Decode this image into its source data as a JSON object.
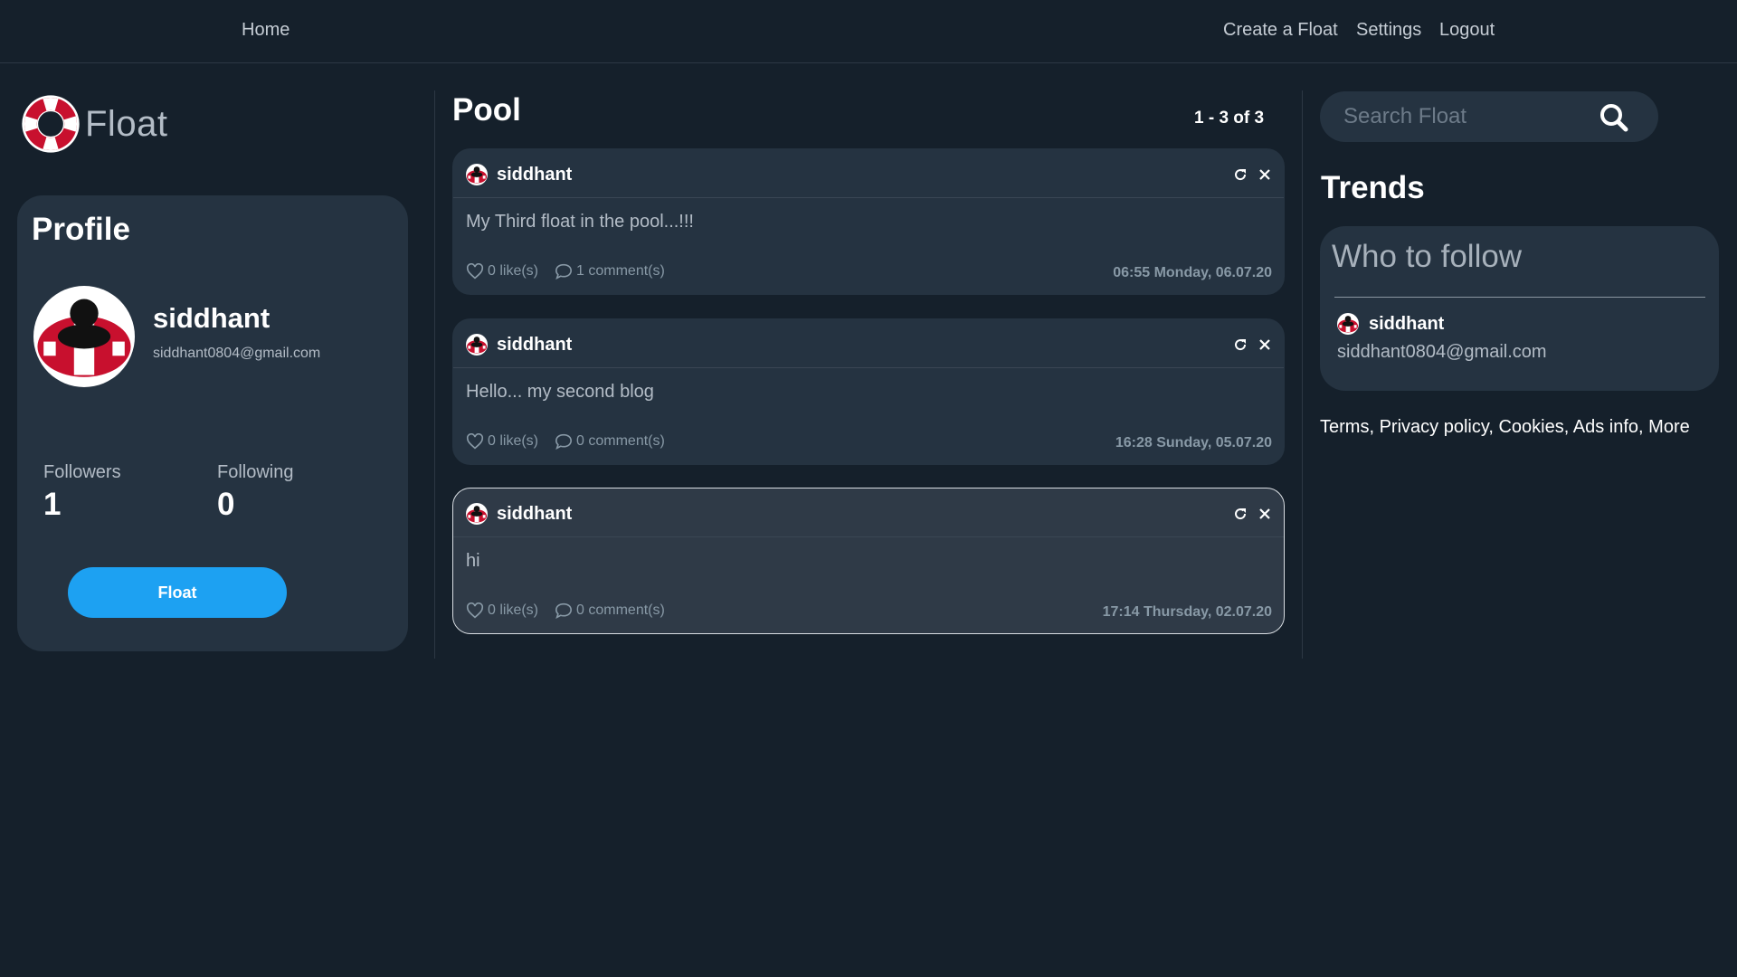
{
  "nav": {
    "home": "Home",
    "create": "Create a Float",
    "settings": "Settings",
    "logout": "Logout"
  },
  "brand": {
    "name": "Float"
  },
  "profile": {
    "title": "Profile",
    "name": "siddhant",
    "email": "siddhant0804@gmail.com",
    "followers_label": "Followers",
    "followers": "1",
    "following_label": "Following",
    "following": "0",
    "float_button": "Float"
  },
  "pool": {
    "title": "Pool",
    "count": "1 - 3 of 3",
    "posts": [
      {
        "author": "siddhant",
        "body": "My Third float in the pool...!!!",
        "likes": "0 like(s)",
        "comments": "1 comment(s)",
        "time": "06:55 Monday, 06.07.20"
      },
      {
        "author": "siddhant",
        "body": "Hello... my second blog",
        "likes": "0 like(s)",
        "comments": "0 comment(s)",
        "time": "16:28 Sunday, 05.07.20"
      },
      {
        "author": "siddhant",
        "body": "hi",
        "likes": "0 like(s)",
        "comments": "0 comment(s)",
        "time": "17:14 Thursday, 02.07.20"
      }
    ]
  },
  "search": {
    "placeholder": "Search Float"
  },
  "trends": {
    "title": "Trends",
    "who_to_follow": {
      "title": "Who to follow",
      "user": {
        "name": "siddhant",
        "email": "siddhant0804@gmail.com"
      }
    }
  },
  "footer": {
    "terms": "Terms",
    "privacy": "Privacy policy",
    "cookies": "Cookies",
    "ads": "Ads info",
    "more": "More"
  },
  "colors": {
    "background": "#15202b",
    "card": "#253341",
    "accent": "#1da1f2",
    "lifebuoy_red": "#c8102e"
  },
  "icons": {
    "logo": "lifebuoy-icon",
    "refresh": "refresh-icon",
    "close": "close-icon",
    "like": "heart-icon",
    "comment": "comment-icon",
    "search": "search-icon"
  }
}
